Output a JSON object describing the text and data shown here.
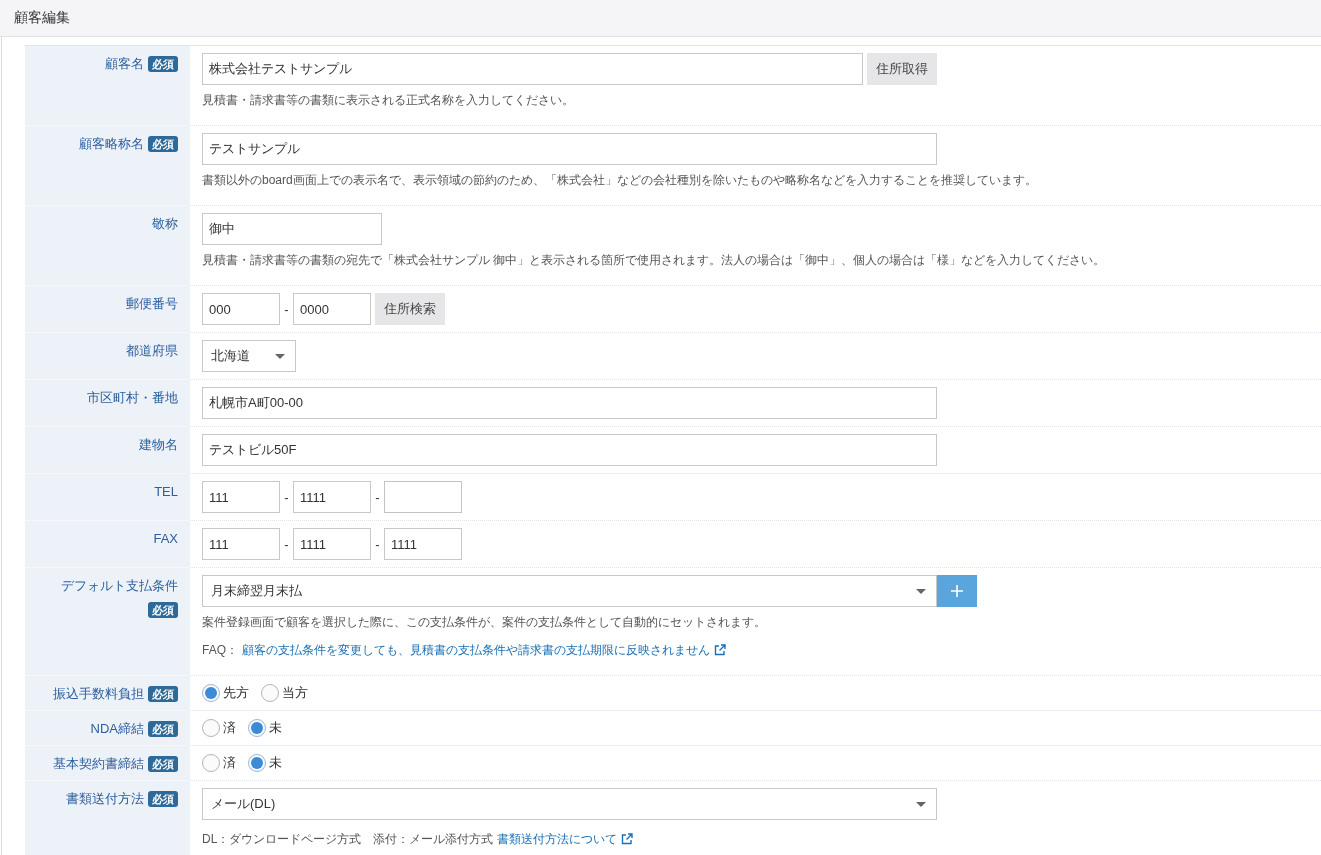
{
  "header": {
    "title": "顧客編集"
  },
  "rows": [
    {
      "kind": "text",
      "label": "顧客名",
      "badge": "必須",
      "value": "株式会社テストサンプル",
      "button": "住所取得",
      "help": "見積書・請求書等の書類に表示される正式名称を入力してください。"
    },
    {
      "kind": "text",
      "label": "顧客略称名",
      "badge": "必須",
      "value": "テストサンプル",
      "help": "書類以外のboard画面上での表示名で、表示領域の節約のため、「株式会社」などの会社種別を除いたものや略称名などを入力することを推奨しています。"
    },
    {
      "kind": "shorttext",
      "label": "敬称",
      "value": "御中",
      "help": "見積書・請求書等の書類の宛先で「株式会社サンプル 御中」と表示される箇所で使用されます。法人の場合は「御中」、個人の場合は「様」などを入力してください。"
    },
    {
      "kind": "split",
      "label": "郵便番号",
      "separator": "-",
      "parts": [
        {
          "value": "000"
        },
        {
          "value": "0000"
        }
      ],
      "button": "住所検索"
    },
    {
      "kind": "dropdown",
      "label": "都道府県",
      "value": "北海道"
    },
    {
      "kind": "text",
      "label": "市区町村・番地",
      "value": "札幌市A町00-00"
    },
    {
      "kind": "text",
      "label": "建物名",
      "value": "テストビル50F"
    },
    {
      "kind": "split",
      "label": "TEL",
      "separator": "-",
      "parts": [
        {
          "value": "111"
        },
        {
          "value": "1111"
        },
        {
          "empty": true
        }
      ]
    },
    {
      "kind": "split",
      "label": "FAX",
      "separator": "-",
      "parts": [
        {
          "value": "111"
        },
        {
          "value": "1111"
        },
        {
          "value": "1111"
        }
      ]
    },
    {
      "kind": "select",
      "label": "デフォルト支払条件",
      "badge": "必須",
      "value": "月末締翌月末払",
      "add": true,
      "help": "案件登録画面で顧客を選択した際に、この支払条件が、案件の支払条件として自動的にセットされます。",
      "note": {
        "prefix": "FAQ：",
        "link": "顧客の支払条件を変更しても、見積書の支払条件や請求書の支払期限に反映されません"
      }
    },
    {
      "kind": "radio",
      "label": "振込手数料負担",
      "badge": "必須",
      "options": [
        {
          "label": "先方",
          "selected": true
        },
        {
          "label": "当方",
          "selected": false
        }
      ]
    },
    {
      "kind": "radio",
      "label": "NDA締結",
      "badge": "必須",
      "options": [
        {
          "label": "済",
          "selected": false
        },
        {
          "label": "未",
          "selected": true
        }
      ]
    },
    {
      "kind": "radio",
      "label": "基本契約書締結",
      "badge": "必須",
      "options": [
        {
          "label": "済",
          "selected": false
        },
        {
          "label": "未",
          "selected": true
        }
      ]
    },
    {
      "kind": "select",
      "label": "書類送付方法",
      "badge": "必須",
      "value": "メール(DL)",
      "note": {
        "prefix": "DL：ダウンロードページ方式　添付：メール添付方式",
        "link": "書類送付方法について"
      }
    }
  ]
}
